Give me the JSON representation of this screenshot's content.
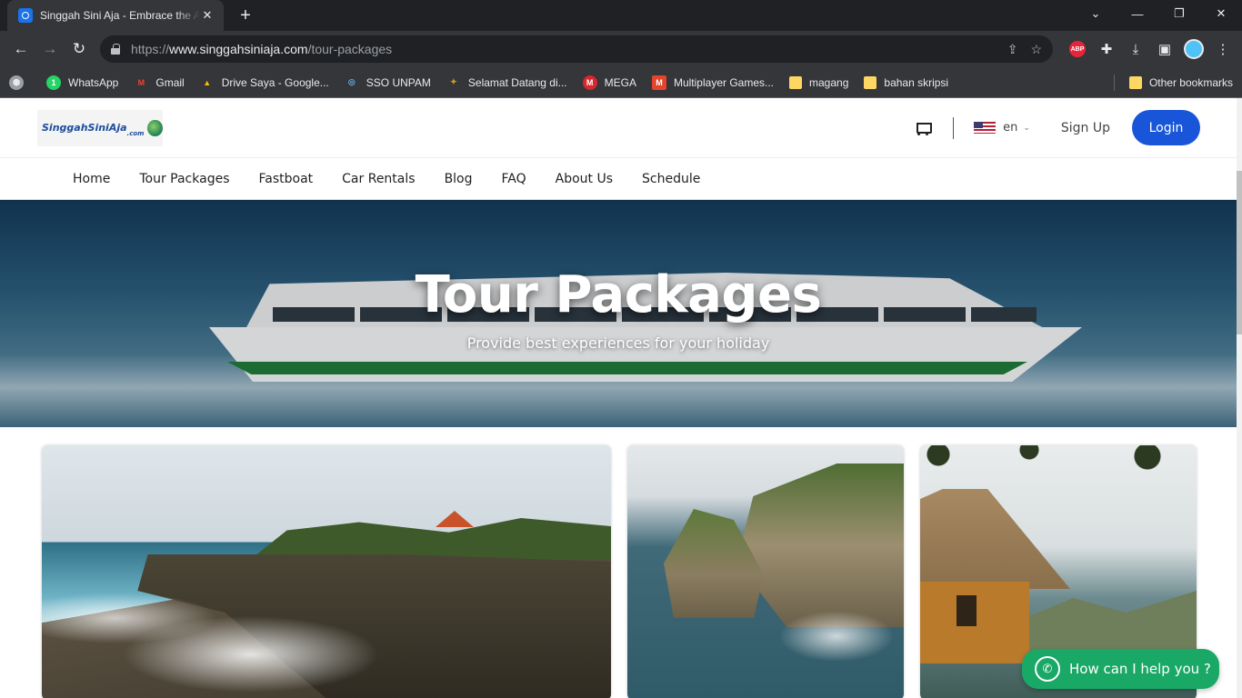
{
  "browser": {
    "tab_title": "Singgah Sini Aja - Embrace the Adventure",
    "tab_close": "✕",
    "new_tab": "+",
    "url_prefix": "https://",
    "url_host": "www.singgahsiniaja.com",
    "url_path": "/tour-packages",
    "abp_label": "ABP"
  },
  "bookmarks": [
    {
      "label": "WhatsApp",
      "color": "#25d366",
      "glyph": "1"
    },
    {
      "label": "Gmail",
      "color": "#ea4335",
      "glyph": "M"
    },
    {
      "label": "Drive Saya - Google...",
      "color": "#fbbc04",
      "glyph": "▲"
    },
    {
      "label": "SSO UNPAM",
      "color": "#5aa9e6",
      "glyph": "◎"
    },
    {
      "label": "Selamat Datang di...",
      "color": "#d4a017",
      "glyph": "✦"
    },
    {
      "label": "MEGA",
      "color": "#d9272e",
      "glyph": "M"
    },
    {
      "label": "Multiplayer Games...",
      "color": "#e2452b",
      "glyph": "M"
    },
    {
      "label": "magang",
      "color": "folder"
    },
    {
      "label": "bahan skripsi",
      "color": "folder"
    }
  ],
  "other_bookmarks": "Other bookmarks",
  "site": {
    "logo_text": "SinggahSiniAja",
    "logo_sub": ".com",
    "lang": "en",
    "signup": "Sign Up",
    "login": "Login",
    "nav": [
      "Home",
      "Tour Packages",
      "Fastboat",
      "Car Rentals",
      "Blog",
      "FAQ",
      "About Us",
      "Schedule"
    ],
    "hero_title": "Tour Packages",
    "hero_subtitle": "Provide best experiences for your holiday",
    "whatsapp_label": "How can I help you ?"
  }
}
